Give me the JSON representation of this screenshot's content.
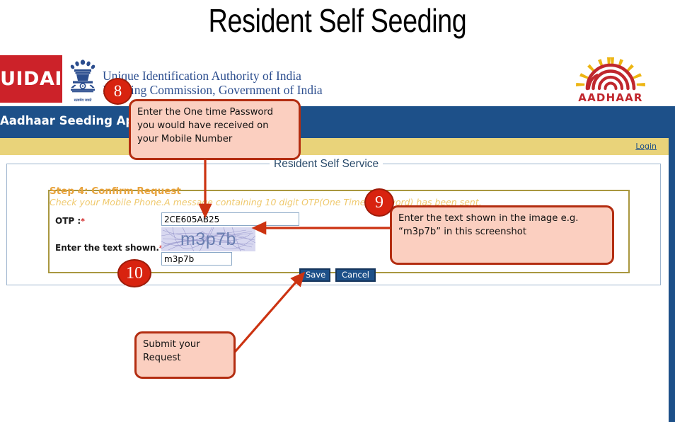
{
  "slide": {
    "title": "Resident Self Seeding"
  },
  "header": {
    "logo_text": "UIDAI",
    "emblem_label": "सत्यमेव जयते",
    "org_line1": "Unique Identification Authority of India",
    "org_line2": "Planning Commission, Government of India",
    "aadhaar_word": "AADHAAR"
  },
  "navbar": {
    "title": "Aadhaar Seeding Application"
  },
  "subbar": {
    "login_label": "Login"
  },
  "panel": {
    "legend": "Resident Self Service",
    "step_title": "Step 4: Confirm Request",
    "step_subtitle": "Check your Mobile Phone.A message containing 10 digit OTP(One Time Password) has been sent."
  },
  "form": {
    "otp_label": "OTP :",
    "otp_value": "2CE605AB25",
    "otp_placeholder": "",
    "captcha_label": "Enter the text shown.",
    "captcha_image_text": "m3p7b",
    "captcha_value": "m3p7b",
    "captcha_placeholder": "",
    "required_mark": "*",
    "save_label": "Save",
    "cancel_label": "Cancel"
  },
  "annotations": [
    {
      "badge": "8",
      "text": "Enter the One time Password you would have received on your Mobile Number"
    },
    {
      "badge": "9",
      "text": "Enter the text shown in the image e.g. “m3p7b” in this screenshot"
    },
    {
      "badge": "10",
      "text": "Submit your Request"
    }
  ],
  "colors": {
    "uidai_red": "#cc2229",
    "nav_blue": "#1d5089",
    "sub_yellow": "#e9d37a",
    "callout_fill": "#fbcfc0",
    "callout_border": "#b32d11",
    "badge_red": "#d8230f",
    "aadhaar_red": "#c0272d",
    "aadhaar_yellow": "#edb512",
    "step_orange": "#e8a33d"
  }
}
